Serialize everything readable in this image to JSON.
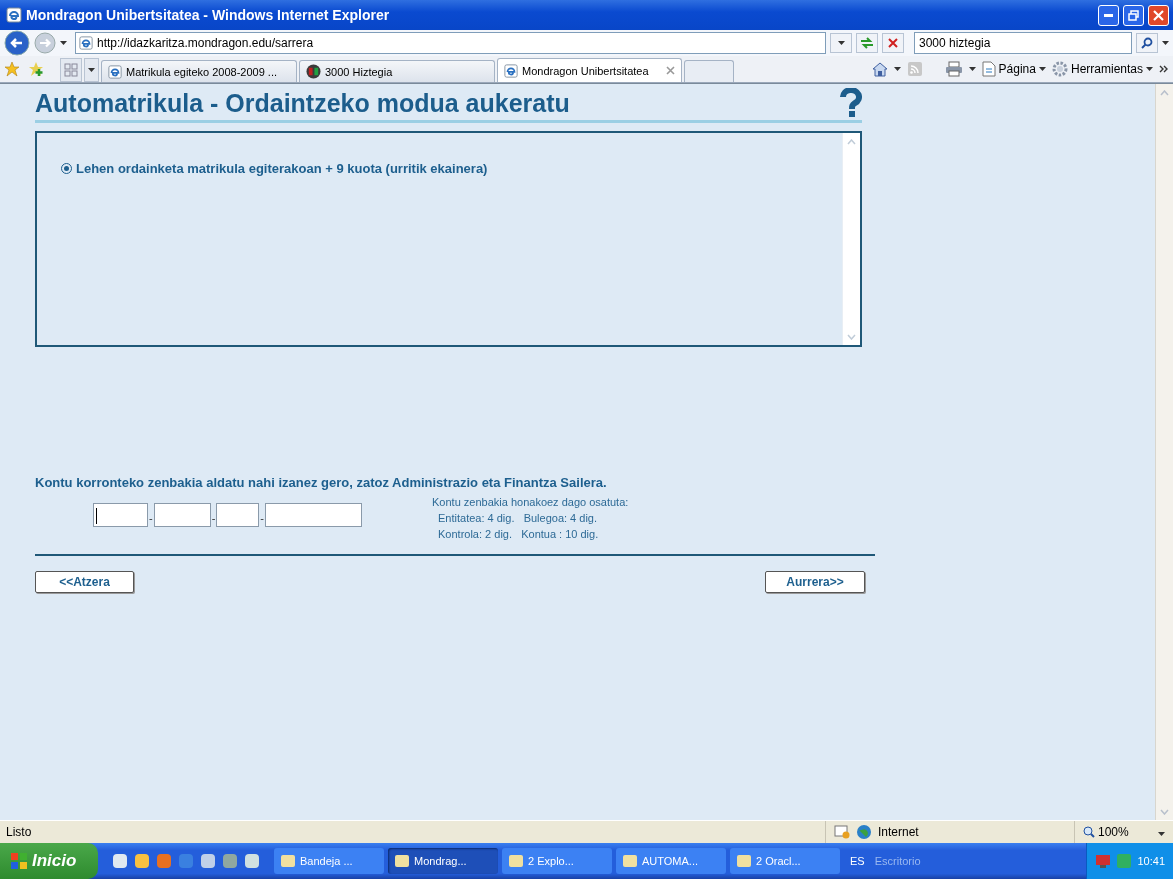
{
  "window": {
    "title": "Mondragon Unibertsitatea - Windows Internet Explorer"
  },
  "nav": {
    "address": "http://idazkaritza.mondragon.edu/sarrera",
    "search_value": "3000 hiztegia"
  },
  "tabs": [
    {
      "label": "Matrikula egiteko 2008-2009 ...",
      "kind": "ie",
      "selected": false
    },
    {
      "label": "3000 Hiztegia",
      "kind": "book",
      "selected": false
    },
    {
      "label": "Mondragon Unibertsitatea",
      "kind": "ie",
      "selected": true
    }
  ],
  "command_bar": [
    "Página",
    "Herramientas"
  ],
  "page": {
    "heading": "Automatrikula - Ordaintzeko modua aukeratu",
    "options": [
      {
        "label": "Lehen ordainketa matrikula egiterakoan + 9 kuota (urritik ekainera)",
        "selected": true
      }
    ],
    "notice": "Kontu korronteko zenbakia aldatu nahi izanez gero, zatoz Administrazio eta Finantza Sailera.",
    "account_fields": [
      {
        "kind": "entitatea",
        "focused": true
      },
      {
        "kind": "bulegoa",
        "focused": false
      },
      {
        "kind": "kontrola",
        "focused": false
      },
      {
        "kind": "kontua",
        "focused": false
      }
    ],
    "separator": "-",
    "info": [
      "Kontu zenbakia honakoez dago osatuta:",
      "Entitatea: 4 dig.   Bulegoa: 4 dig.",
      "Kontrola: 2 dig.   Kontua : 10 dig."
    ],
    "back_button": "<<Atzera",
    "next_button": "Aurrera>>"
  },
  "status_bar": {
    "text": "Listo",
    "zone": "Internet",
    "zoom": "100%"
  },
  "taskbar": {
    "start": "Inicio",
    "tasks": [
      {
        "label": "Bandeja ...",
        "active": false
      },
      {
        "label": "Mondrag...",
        "active": true
      },
      {
        "label": "2 Explo...",
        "active": false
      },
      {
        "label": "AUTOMA...",
        "active": false
      },
      {
        "label": "2 Oracl...",
        "active": false
      }
    ],
    "language": "ES",
    "desktop": "Escritorio",
    "clock": "10:41"
  }
}
